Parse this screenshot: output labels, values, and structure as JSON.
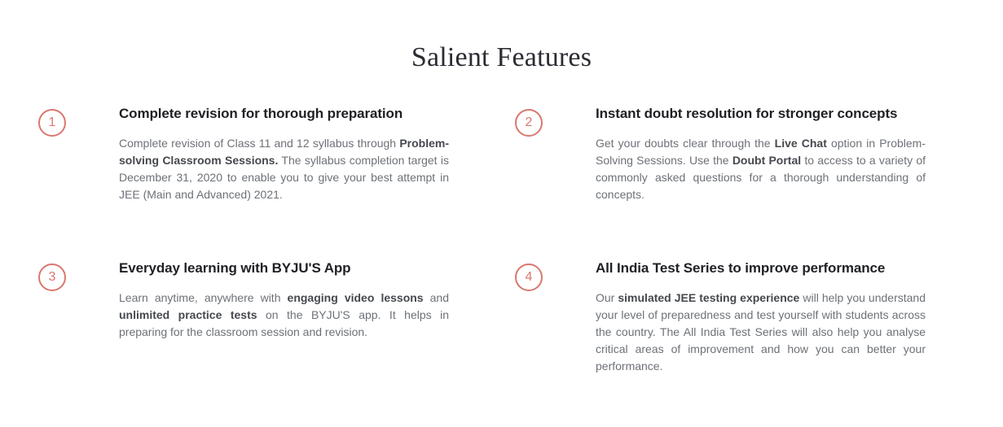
{
  "section": {
    "title": "Salient Features"
  },
  "theme": {
    "badge_color": "#d9786f",
    "heading_color": "#1f2024",
    "body_color": "#6d7177",
    "bold_color": "#45484d",
    "background": "#ffffff"
  },
  "features": [
    {
      "number": "1",
      "heading": "Complete revision for thorough preparation",
      "body_segments": [
        {
          "text": "Complete revision of Class 11 and 12 syllabus through ",
          "bold": false
        },
        {
          "text": "Problem-solving Classroom Sessions.",
          "bold": true
        },
        {
          "text": " The syllabus completion target is December 31, 2020 to enable you to give your best attempt in JEE (Main and Advanced) 2021.",
          "bold": false
        }
      ]
    },
    {
      "number": "2",
      "heading": "Instant doubt resolution for stronger concepts",
      "body_segments": [
        {
          "text": "Get your doubts clear through the ",
          "bold": false
        },
        {
          "text": "Live Chat",
          "bold": true
        },
        {
          "text": " option in Problem-Solving Sessions. Use the ",
          "bold": false
        },
        {
          "text": "Doubt Portal",
          "bold": true
        },
        {
          "text": " to access to a variety of commonly asked questions for a thorough understanding of concepts.",
          "bold": false
        }
      ]
    },
    {
      "number": "3",
      "heading": "Everyday learning with BYJU'S App",
      "body_segments": [
        {
          "text": "Learn anytime, anywhere with ",
          "bold": false
        },
        {
          "text": "engaging video lessons",
          "bold": true
        },
        {
          "text": " and ",
          "bold": false
        },
        {
          "text": "unlimited practice tests",
          "bold": true
        },
        {
          "text": " on the BYJU'S app. It helps in preparing for the classroom session and revision.",
          "bold": false
        }
      ]
    },
    {
      "number": "4",
      "heading": "All India Test Series to improve performance",
      "body_segments": [
        {
          "text": "Our ",
          "bold": false
        },
        {
          "text": "simulated JEE testing experience",
          "bold": true
        },
        {
          "text": " will help you understand your level of preparedness and test yourself with students across the country. The All India Test Series will also help you analyse critical areas of improvement and how you can better your performance.",
          "bold": false
        }
      ]
    }
  ]
}
